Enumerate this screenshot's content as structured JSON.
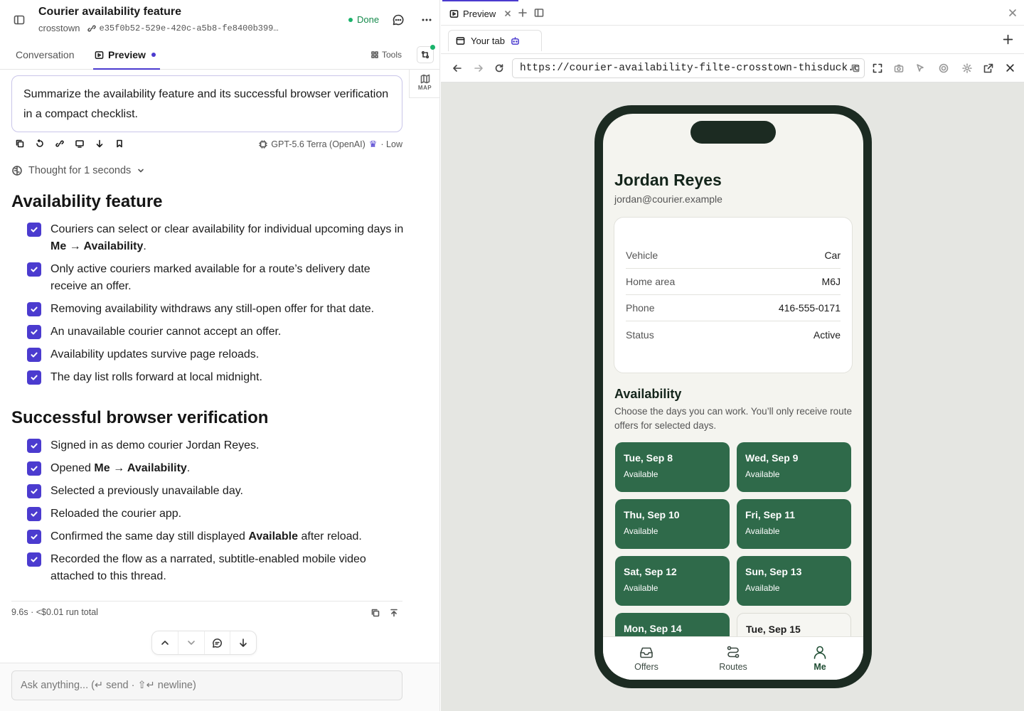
{
  "header": {
    "title": "Courier availability feature",
    "repo": "crosstown",
    "commit": "e35f0b52-529e-420c-a5b8-fe8400b399…",
    "status": "Done"
  },
  "tabs": {
    "conversation": "Conversation",
    "preview": "Preview",
    "tools": "Tools"
  },
  "rail": {
    "map": "MAP"
  },
  "prompt": {
    "text": "Summarize the availability feature and its successful browser verification in a compact checklist."
  },
  "model": {
    "name": "GPT-5.6 Terra (OpenAI)",
    "effort": "· Low"
  },
  "thought": "Thought for 1 seconds",
  "sections": [
    {
      "heading": "Availability feature",
      "items": [
        {
          "pre": "Couriers can select or clear availability for individual upcoming days in ",
          "b": "Me → Availability",
          "post": "."
        },
        {
          "pre": "Only active couriers marked available for a route’s delivery date receive an offer.",
          "b": "",
          "post": ""
        },
        {
          "pre": "Removing availability withdraws any still-open offer for that date.",
          "b": "",
          "post": ""
        },
        {
          "pre": "An unavailable courier cannot accept an offer.",
          "b": "",
          "post": ""
        },
        {
          "pre": "Availability updates survive page reloads.",
          "b": "",
          "post": ""
        },
        {
          "pre": "The day list rolls forward at local midnight.",
          "b": "",
          "post": ""
        }
      ]
    },
    {
      "heading": "Successful browser verification",
      "items": [
        {
          "pre": "Signed in as demo courier Jordan Reyes.",
          "b": "",
          "post": ""
        },
        {
          "pre": "Opened ",
          "b": "Me → Availability",
          "post": "."
        },
        {
          "pre": "Selected a previously unavailable day.",
          "b": "",
          "post": ""
        },
        {
          "pre": "Reloaded the courier app.",
          "b": "",
          "post": ""
        },
        {
          "pre": "Confirmed the same day still displayed ",
          "b": "Available",
          "post": " after reload."
        },
        {
          "pre": "Recorded the flow as a narrated, subtitle-enabled mobile video attached to this thread.",
          "b": "",
          "post": ""
        }
      ]
    }
  ],
  "stats": "9.6s · <$0.01 run total",
  "input": {
    "placeholder": "Ask anything... (↵ send · ⇧↵ newline)"
  },
  "browser": {
    "tab_label": "Preview",
    "page_tab": "Your tab",
    "url": "https://courier-availability-filte-crosstown-thisduck.c"
  },
  "profile": {
    "name": "Jordan Reyes",
    "email": "jordan@courier.example",
    "details": [
      {
        "label": "Vehicle",
        "value": "Car"
      },
      {
        "label": "Home area",
        "value": "M6J"
      },
      {
        "label": "Phone",
        "value": "416-555-0171"
      },
      {
        "label": "Status",
        "value": "Active"
      }
    ]
  },
  "availability": {
    "heading": "Availability",
    "description": "Choose the days you can work. You’ll only receive route offers for selected days.",
    "days": [
      {
        "date": "Tue, Sep 8",
        "status": "Available",
        "selected": true
      },
      {
        "date": "Wed, Sep 9",
        "status": "Available",
        "selected": true
      },
      {
        "date": "Thu, Sep 10",
        "status": "Available",
        "selected": true
      },
      {
        "date": "Fri, Sep 11",
        "status": "Available",
        "selected": true
      },
      {
        "date": "Sat, Sep 12",
        "status": "Available",
        "selected": true
      },
      {
        "date": "Sun, Sep 13",
        "status": "Available",
        "selected": true
      },
      {
        "date": "Mon, Sep 14",
        "status": "",
        "selected": true
      },
      {
        "date": "Tue, Sep 15",
        "status": "",
        "selected": false
      }
    ]
  },
  "tabbar": [
    {
      "label": "Offers",
      "icon": "inbox-icon",
      "active": false
    },
    {
      "label": "Routes",
      "icon": "route-icon",
      "active": false
    },
    {
      "label": "Me",
      "icon": "person-icon",
      "active": true
    }
  ],
  "colors": {
    "accent": "#4b3bcf",
    "brand_green": "#2f6a4a",
    "status_done": "#168a4c"
  }
}
